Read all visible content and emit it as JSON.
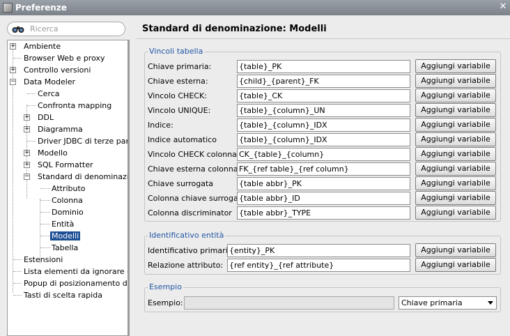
{
  "window": {
    "title": "Preferenze"
  },
  "search": {
    "placeholder": "Ricerca"
  },
  "tree": [
    {
      "label": "Ambiente"
    },
    {
      "label": "Browser Web e proxy"
    },
    {
      "label": "Controllo versioni"
    },
    {
      "label": "Data Modeler"
    },
    {
      "label": "Cerca"
    },
    {
      "label": "Confronta mapping"
    },
    {
      "label": "DDL"
    },
    {
      "label": "Diagramma"
    },
    {
      "label": "Driver JDBC di terze parti"
    },
    {
      "label": "Modello"
    },
    {
      "label": "SQL Formatter"
    },
    {
      "label": "Standard di denominazione"
    },
    {
      "label": "Attributo"
    },
    {
      "label": "Colonna"
    },
    {
      "label": "Dominio"
    },
    {
      "label": "Entità"
    },
    {
      "label": "Modelli",
      "selected": true
    },
    {
      "label": "Tabella"
    },
    {
      "label": "Estensioni"
    },
    {
      "label": "Lista elementi da ignorare glob"
    },
    {
      "label": "Popup di posizionamento del m"
    },
    {
      "label": "Tasti di scelta rapida"
    }
  ],
  "page": {
    "title": "Standard di denominazione: Modelli"
  },
  "vincoli": {
    "title": "Vincoli tabella",
    "button_label": "Aggiungi variabile",
    "rows": [
      {
        "label": "Chiave primaria:",
        "value": "{table}_PK"
      },
      {
        "label": "Chiave esterna:",
        "value": "{child}_{parent}_FK"
      },
      {
        "label": "Vincolo CHECK:",
        "value": "{table}_CK"
      },
      {
        "label": "Vincolo UNIQUE:",
        "value": "{table}_{column}_UN"
      },
      {
        "label": "Indice:",
        "value": "{table}_{column}_IDX"
      },
      {
        "label": "Indice automatico",
        "value": "{table}_{column}_IDX"
      },
      {
        "label": "Vincolo CHECK colonna:",
        "value": "CK_{table}_{column}"
      },
      {
        "label": "Chiave esterna colonna:",
        "value": "FK_{ref table}_{ref column}"
      },
      {
        "label": "Chiave surrogata",
        "value": "{table abbr}_PK"
      },
      {
        "label": "Colonna chiave surrogata",
        "value": "{table abbr}_ID"
      },
      {
        "label": "Colonna discriminator",
        "value": "{table abbr}_TYPE"
      }
    ]
  },
  "identificativo": {
    "title": "Identificativo entità",
    "button_label": "Aggiungi variabile",
    "rows": [
      {
        "label": "Identificativo primario:",
        "value": "{entity}_PK"
      },
      {
        "label": "Relazione attributo:",
        "value": "{ref entity}_{ref attribute}"
      }
    ]
  },
  "esempio": {
    "title": "Esempio",
    "label": "Esempio:",
    "value": "",
    "select_value": "Chiave primaria"
  }
}
